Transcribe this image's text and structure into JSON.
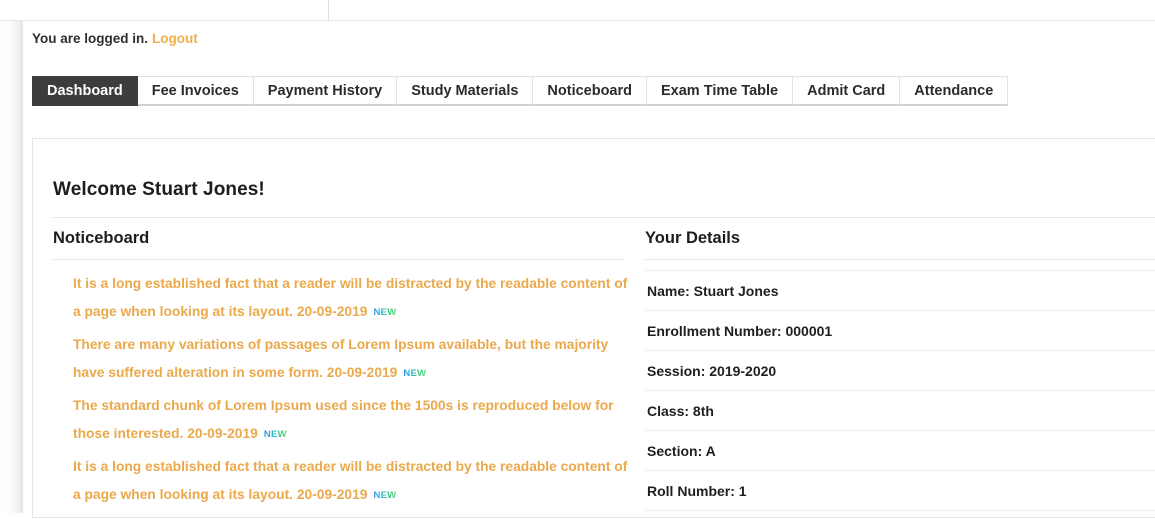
{
  "login_bar": {
    "status_text": "You are logged in.",
    "logout_label": "Logout"
  },
  "tabs": [
    {
      "label": "Dashboard",
      "active": true
    },
    {
      "label": "Fee Invoices",
      "active": false
    },
    {
      "label": "Payment History",
      "active": false
    },
    {
      "label": "Study Materials",
      "active": false
    },
    {
      "label": "Noticeboard",
      "active": false
    },
    {
      "label": "Exam Time Table",
      "active": false
    },
    {
      "label": "Admit Card",
      "active": false
    },
    {
      "label": "Attendance",
      "active": false
    }
  ],
  "main": {
    "page_title": "Welcome Stuart Jones!",
    "noticeboard": {
      "heading": "Noticeboard",
      "badge_label": "NEW",
      "items": [
        {
          "text": "It is a long established fact that a reader will be distracted by the readable content of a page when looking at its layout. 20-09-2019",
          "badge": "NEW"
        },
        {
          "text": "There are many variations of passages of Lorem Ipsum available, but the majority have suffered alteration in some form. 20-09-2019",
          "badge": "NEW"
        },
        {
          "text": "The standard chunk of Lorem Ipsum used since the 1500s is reproduced below for those interested. 20-09-2019",
          "badge": "NEW"
        },
        {
          "text": "It is a long established fact that a reader will be distracted by the readable content of a page when looking at its layout. 20-09-2019",
          "badge": "NEW"
        }
      ]
    },
    "details": {
      "heading": "Your Details",
      "rows": [
        "Name: Stuart Jones",
        "Enrollment Number: 000001",
        "Session: 2019-2020",
        "Class: 8th",
        "Section: A",
        "Roll Number: 1"
      ]
    }
  },
  "colors": {
    "accent_orange": "#f0ad4e",
    "notice_text": "#eaa94b",
    "active_tab_bg": "#3d3d3d",
    "text_dark": "#1f1f1f",
    "rule": "#e4e4e4"
  }
}
